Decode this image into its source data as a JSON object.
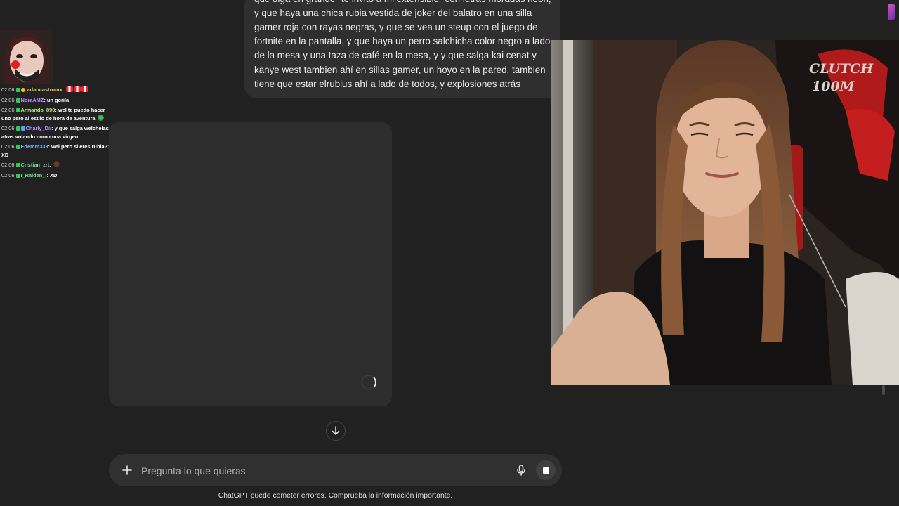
{
  "stream_chat": {
    "messages": [
      {
        "time": "02:06",
        "user": "adancastromx",
        "user_color": "#f3c14b",
        "text": ""
      },
      {
        "time": "02:06",
        "user": "NoraAMZ",
        "user_color": "#c48cff",
        "text": "un gorila"
      },
      {
        "time": "02:06",
        "user": "Armando_890",
        "user_color": "#b8e986",
        "text": "wel te puedo hacer uno pero al estilo de hora de aventura"
      },
      {
        "time": "02:06",
        "user": "Charly_Dii",
        "user_color": "#b38cff",
        "text": "y que salga welchelas atras volando como una virgen"
      },
      {
        "time": "02:06",
        "user": "Edemm333",
        "user_color": "#7ab8ff",
        "text": "wel pero si eres rubia?? XD"
      },
      {
        "time": "02:06",
        "user": "Cristian_zrt",
        "user_color": "#6fdc8c",
        "text": ""
      },
      {
        "time": "02:06",
        "user": "I_Raiden_I",
        "user_color": "#6fdc8c",
        "text": "XD"
      }
    ]
  },
  "conversation": {
    "user_message_lines": [
      "que diga en grande \"te invito a mi extensible\" con letras moradas neon,",
      "y que haya una chica rubia vestida de joker del balatro en una silla",
      "gamer roja con rayas negras, y que se vea un steup con el juego de",
      "fortnite en la pantalla, y que haya un perro salchicha color negro a lado",
      "de la mesa y una taza de café en la mesa, y y que salga kai cenat y",
      "kanye west tambien ahí en sillas gamer, un hoyo en la pared, tambien",
      "tiene que estar elrubius ahí a lado de todos, y explosiones atrás"
    ]
  },
  "composer": {
    "placeholder": "Pregunta lo que quieras"
  },
  "footer": {
    "disclaimer": "ChatGPT puede cometer errores. Comprueba la información importante."
  },
  "webcam": {
    "chair_text_line1": "CLUTCH",
    "chair_text_line2": "100M"
  },
  "colors": {
    "background": "#212121",
    "bubble": "#2f2f2f",
    "composer": "#303030"
  }
}
